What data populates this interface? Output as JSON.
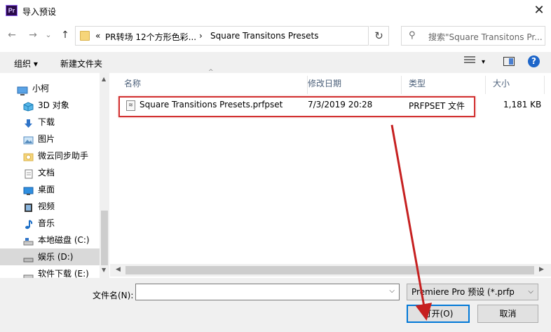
{
  "window": {
    "title": "导入预设",
    "app_icon_text": "Pr",
    "close_glyph": "✕"
  },
  "navigation": {
    "back_glyph": "←",
    "forward_glyph": "→",
    "recent_glyph": "⌄",
    "up_glyph": "↑",
    "breadcrumb_overflow": "«",
    "breadcrumb": [
      "PR转场 12个方形色彩...",
      "Square Transitons Presets"
    ],
    "separator": "›",
    "refresh_glyph": "↻",
    "search_placeholder": "搜索\"Square Transitons Pr..."
  },
  "toolbar": {
    "organize_label": "组织 ▾",
    "new_folder_label": "新建文件夹",
    "view_caret": "▾",
    "help_label": "?"
  },
  "sidebar": {
    "items": [
      {
        "label": "小柯",
        "icon": "computer-icon"
      },
      {
        "label": "3D 对象",
        "icon": "cube-icon"
      },
      {
        "label": "下载",
        "icon": "download-icon"
      },
      {
        "label": "图片",
        "icon": "pictures-icon"
      },
      {
        "label": "微云同步助手",
        "icon": "cloud-sync-icon"
      },
      {
        "label": "文档",
        "icon": "documents-icon"
      },
      {
        "label": "桌面",
        "icon": "desktop-icon"
      },
      {
        "label": "视频",
        "icon": "video-icon"
      },
      {
        "label": "音乐",
        "icon": "music-icon"
      },
      {
        "label": "本地磁盘 (C:)",
        "icon": "drive-icon"
      },
      {
        "label": "娱乐 (D:)",
        "icon": "drive-icon",
        "selected": true
      },
      {
        "label": "软件下载 (E:)",
        "icon": "drive-icon"
      }
    ]
  },
  "filelist": {
    "columns": [
      "名称",
      "修改日期",
      "类型",
      "大小"
    ],
    "rows": [
      {
        "name": "Square Transitions Presets.prfpset",
        "date": "7/3/2019 20:28",
        "type": "PRFPSET 文件",
        "size": "1,181 KB"
      }
    ]
  },
  "footer": {
    "filename_label": "文件名(N):",
    "filename_value": "",
    "filetype_value": "Premiere Pro 预设 (*.prfp",
    "open_label": "打开(O)",
    "cancel_label": "取消"
  },
  "colors": {
    "highlight": "#d23131",
    "accent": "#0078d7",
    "toolbar_bg": "#f0f0f0",
    "selected_bg": "#d9d9d9"
  }
}
